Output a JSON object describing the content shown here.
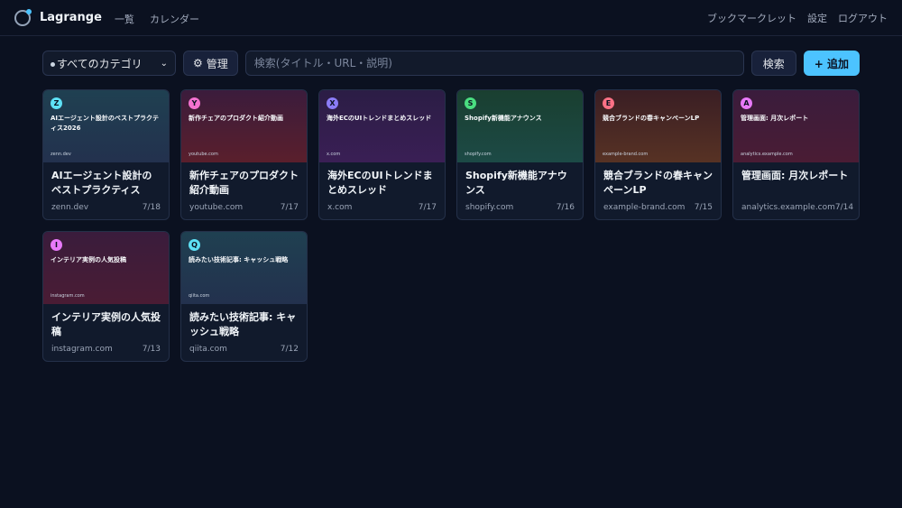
{
  "header": {
    "brand": "Lagrange",
    "nav": [
      "一覧",
      "カレンダー"
    ],
    "right": [
      "ブックマークレット",
      "設定",
      "ログアウト"
    ]
  },
  "toolbar": {
    "category": "すべてのカテゴリ",
    "manage_label": "管理",
    "search_placeholder": "検索(タイトル・URL・説明)",
    "search_label": "検索",
    "add_label": "+ 追加"
  },
  "cards": [
    {
      "badge": "Z",
      "thumb_title": "AIエージェント設計のベストプラクティス2026",
      "thumb_domain": "zenn.dev",
      "title": "AIエージェント設計のベストプラクティス2026",
      "domain": "zenn.dev",
      "date": "7/18",
      "badge_color": "#5ee1f5",
      "grad": [
        "#1f4051",
        "#23314e"
      ]
    },
    {
      "badge": "Y",
      "thumb_title": "新作チェアのプロダクト紹介動画",
      "thumb_domain": "youtube.com",
      "title": "新作チェアのプロダクト紹介動画",
      "domain": "youtube.com",
      "date": "7/17",
      "badge_color": "#f472d0",
      "grad": [
        "#3b1c3c",
        "#5a1f2c"
      ]
    },
    {
      "badge": "X",
      "thumb_title": "海外ECのUIトレンドまとめスレッド",
      "thumb_domain": "x.com",
      "title": "海外ECのUIトレンドまとめスレッド",
      "domain": "x.com",
      "date": "7/17",
      "badge_color": "#8b7cf6",
      "grad": [
        "#2b1d45",
        "#3a1f55"
      ]
    },
    {
      "badge": "S",
      "thumb_title": "Shopify新機能アナウンス",
      "thumb_domain": "shopify.com",
      "title": "Shopify新機能アナウンス",
      "domain": "shopify.com",
      "date": "7/16",
      "badge_color": "#4ade80",
      "grad": [
        "#1a3f30",
        "#1c4a46"
      ]
    },
    {
      "badge": "E",
      "thumb_title": "競合ブランドの春キャンペーンLP",
      "thumb_domain": "example-brand.com",
      "title": "競合ブランドの春キャンペーンLP",
      "domain": "example-brand.com",
      "date": "7/15",
      "badge_color": "#fb7185",
      "grad": [
        "#3a1e24",
        "#573224"
      ]
    },
    {
      "badge": "A",
      "thumb_title": "管理画面: 月次レポート",
      "thumb_domain": "analytics.example.com",
      "title": "管理画面: 月次レポート",
      "domain": "analytics.example.com",
      "date": "7/14",
      "badge_color": "#e879f9",
      "grad": [
        "#3a1c3c",
        "#4a1c34"
      ]
    },
    {
      "badge": "I",
      "thumb_title": "インテリア実例の人気投稿",
      "thumb_domain": "instagram.com",
      "title": "インテリア実例の人気投稿",
      "domain": "instagram.com",
      "date": "7/13",
      "badge_color": "#e879f9",
      "grad": [
        "#3a1c3c",
        "#4a1c34"
      ]
    },
    {
      "badge": "Q",
      "thumb_title": "読みたい技術記事: キャッシュ戦略",
      "thumb_domain": "qiita.com",
      "title": "読みたい技術記事: キャッシュ戦略",
      "domain": "qiita.com",
      "date": "7/12",
      "badge_color": "#5ee1f5",
      "grad": [
        "#1f4051",
        "#23314e"
      ]
    }
  ]
}
